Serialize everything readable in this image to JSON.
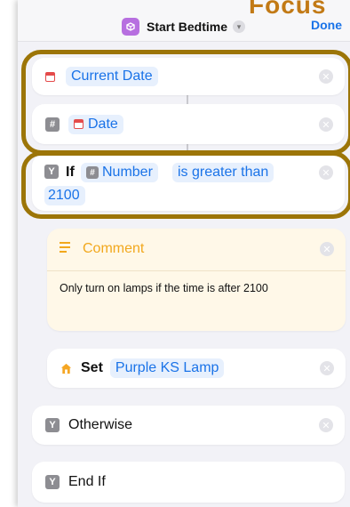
{
  "overlay_label": "Focus",
  "header": {
    "title": "Start Bedtime",
    "done": "Done"
  },
  "actions": {
    "current_date": "Current Date",
    "date_var": "Date",
    "if_keyword": "If",
    "number_var": "Number",
    "condition": "is greater than",
    "condition_value": "2100",
    "comment_title": "Comment",
    "comment_text": "Only turn on lamps if the time is after 2100",
    "set_keyword": "Set",
    "device": "Purple KS Lamp",
    "otherwise": "Otherwise",
    "end_if": "End If"
  },
  "colors": {
    "highlight": "#9c7508",
    "accent": "#1a73e8",
    "comment_yellow": "#f2a81d",
    "comment_bg": "#fff8e8"
  }
}
